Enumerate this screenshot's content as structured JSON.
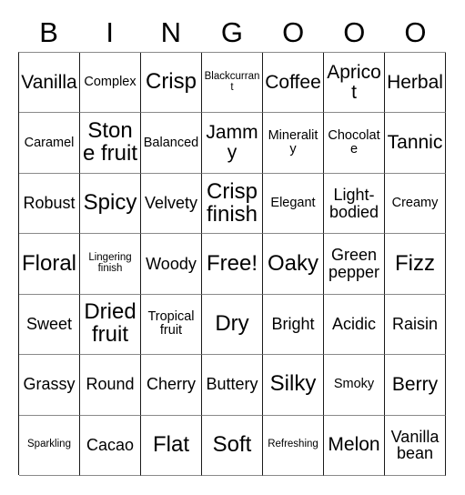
{
  "card": {
    "header_letters": [
      "B",
      "I",
      "N",
      "G",
      "O",
      "O",
      "O"
    ],
    "columns": 7,
    "rows": 7,
    "grid": [
      [
        {
          "label": "Vanilla",
          "size": "lg"
        },
        {
          "label": "Complex",
          "size": "sm"
        },
        {
          "label": "Crisp",
          "size": "xl"
        },
        {
          "label": "Blackcurrant",
          "size": "xs"
        },
        {
          "label": "Coffee",
          "size": "lg"
        },
        {
          "label": "Apricot",
          "size": "lg"
        },
        {
          "label": "Herbal",
          "size": "lg"
        }
      ],
      [
        {
          "label": "Caramel",
          "size": "sm"
        },
        {
          "label": "Stone fruit",
          "size": "xl"
        },
        {
          "label": "Balanced",
          "size": "sm"
        },
        {
          "label": "Jammy",
          "size": "lg"
        },
        {
          "label": "Minerality",
          "size": "sm"
        },
        {
          "label": "Chocolate",
          "size": "sm"
        },
        {
          "label": "Tannic",
          "size": "lg"
        }
      ],
      [
        {
          "label": "Robust",
          "size": "md"
        },
        {
          "label": "Spicy",
          "size": "xl"
        },
        {
          "label": "Velvety",
          "size": "md"
        },
        {
          "label": "Crisp finish",
          "size": "xl"
        },
        {
          "label": "Elegant",
          "size": "sm"
        },
        {
          "label": "Light-bodied",
          "size": "md"
        },
        {
          "label": "Creamy",
          "size": "sm"
        }
      ],
      [
        {
          "label": "Floral",
          "size": "xl"
        },
        {
          "label": "Lingering finish",
          "size": "xs"
        },
        {
          "label": "Woody",
          "size": "md"
        },
        {
          "label": "Free!",
          "size": "xl"
        },
        {
          "label": "Oaky",
          "size": "xl"
        },
        {
          "label": "Green pepper",
          "size": "md"
        },
        {
          "label": "Fizz",
          "size": "xl"
        }
      ],
      [
        {
          "label": "Sweet",
          "size": "md"
        },
        {
          "label": "Dried fruit",
          "size": "xl"
        },
        {
          "label": "Tropical fruit",
          "size": "sm"
        },
        {
          "label": "Dry",
          "size": "xl"
        },
        {
          "label": "Bright",
          "size": "md"
        },
        {
          "label": "Acidic",
          "size": "md"
        },
        {
          "label": "Raisin",
          "size": "md"
        }
      ],
      [
        {
          "label": "Grassy",
          "size": "md"
        },
        {
          "label": "Round",
          "size": "md"
        },
        {
          "label": "Cherry",
          "size": "md"
        },
        {
          "label": "Buttery",
          "size": "md"
        },
        {
          "label": "Silky",
          "size": "xl"
        },
        {
          "label": "Smoky",
          "size": "sm"
        },
        {
          "label": "Berry",
          "size": "lg"
        }
      ],
      [
        {
          "label": "Sparkling",
          "size": "xs"
        },
        {
          "label": "Cacao",
          "size": "md"
        },
        {
          "label": "Flat",
          "size": "xl"
        },
        {
          "label": "Soft",
          "size": "xl"
        },
        {
          "label": "Refreshing",
          "size": "xs"
        },
        {
          "label": "Melon",
          "size": "lg"
        },
        {
          "label": "Vanilla bean",
          "size": "md"
        }
      ]
    ],
    "colors": {
      "background": "#ffffff",
      "text": "#000000",
      "vertical_border": "#1a1a1a",
      "horizontal_border": "#8a8a8a"
    }
  }
}
